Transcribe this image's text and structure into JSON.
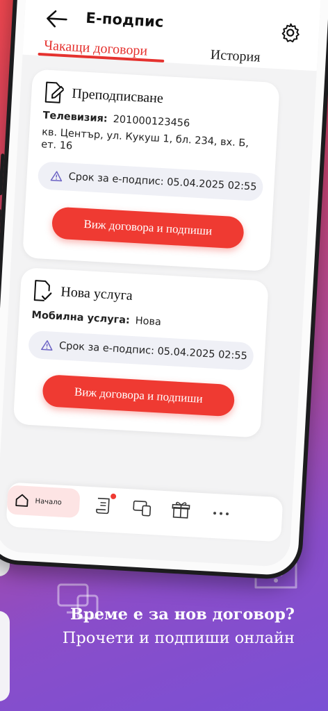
{
  "header": {
    "title": "Е-подпис",
    "back_icon": "arrow-left-icon",
    "settings_icon": "gear-icon"
  },
  "tabs": [
    {
      "label": "Чакащи договори",
      "active": true
    },
    {
      "label": "История",
      "active": false
    }
  ],
  "contracts": [
    {
      "icon": "document-edit-icon",
      "title": "Преподписване",
      "field_label": "Телевизия:",
      "field_value": "201000123456",
      "address_line1": "кв. Център, ул. Кукуш 1, бл. 234, вх. Б,",
      "address_line2": "ет. 16",
      "deadline": "Срок за е-подпис: 05.04.2025 02:55",
      "button": "Виж договора и подпиши"
    },
    {
      "icon": "document-check-icon",
      "title": "Нова услуга",
      "field_label": "Мобилна услуга:",
      "field_value": "Нова",
      "deadline": "Срок за е-подпис: 05.04.2025 02:55",
      "button": "Виж договора и подпиши"
    }
  ],
  "bottom_nav": {
    "home_label": "Начало",
    "items": [
      "home-icon",
      "contract-scroll-icon",
      "devices-icon",
      "gift-icon",
      "more-icon"
    ]
  },
  "tagline": {
    "bold": "Време е за нов договор?",
    "rest": " Прочети и подпиши онлайн"
  },
  "colors": {
    "accent": "#ef3a32",
    "tab_active": "#e5322f",
    "home_pill": "#fde4e4",
    "deadline_bg": "#eff0f6"
  }
}
